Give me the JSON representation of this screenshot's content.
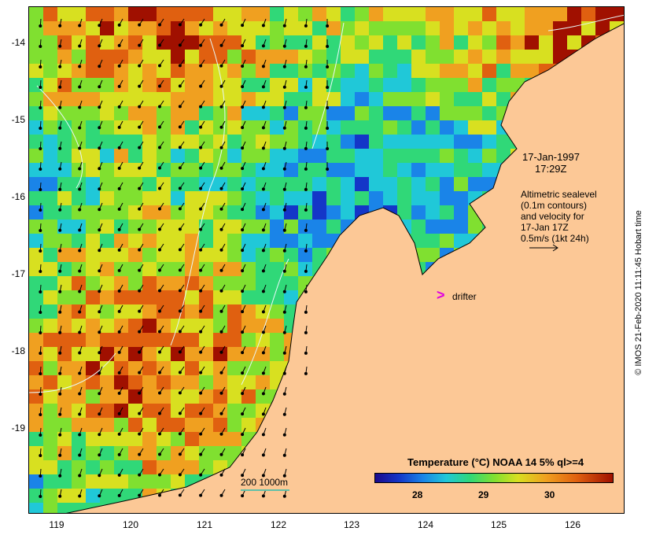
{
  "map": {
    "lat_ticks": [
      "-14",
      "-15",
      "-16",
      "-17",
      "-18",
      "-19"
    ],
    "lon_ticks": [
      "119",
      "120",
      "121",
      "122",
      "123",
      "124",
      "125",
      "126"
    ],
    "date_line1": "17-Jan-1997",
    "date_line2": "17:29Z",
    "altimetry_lines": [
      "Altimetric sealevel",
      "(0.1m contours)",
      "and velocity for",
      "17-Jan 17Z",
      "0.5m/s (1kt 24h)"
    ],
    "drifter_label": "drifter",
    "scale_label": "200  1000m",
    "colorbar_title": "Temperature (°C) NOAA 14 5% ql>=4",
    "colorbar_ticks": [
      "28",
      "29",
      "30"
    ],
    "credit": "© IMOS 21-Feb-2020 11:11:45 Hobart time"
  },
  "colors": {
    "land": "#fcc896",
    "drifter": "#e000e0",
    "ocean_palette": [
      "#1436c8",
      "#1a84e8",
      "#20c8d8",
      "#30d878",
      "#80e030",
      "#d8e020",
      "#f0a020",
      "#e06010",
      "#a01000"
    ]
  }
}
